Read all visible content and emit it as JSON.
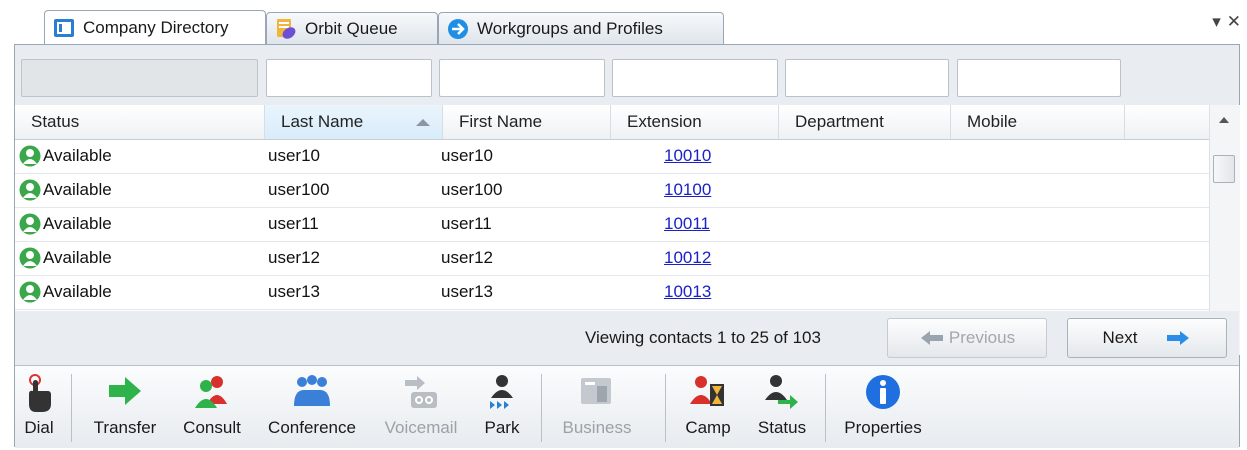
{
  "tabs": [
    {
      "label": "Company Directory",
      "icon": "directory-icon",
      "active": true
    },
    {
      "label": "Orbit Queue",
      "icon": "orbit-queue-icon",
      "active": false
    },
    {
      "label": "Workgroups and Profiles",
      "icon": "workgroups-icon",
      "active": false
    }
  ],
  "tab_controls": {
    "dropdown": "▾",
    "close": "✕"
  },
  "columns": [
    "Status",
    "Last Name",
    "First Name",
    "Extension",
    "Department",
    "Mobile"
  ],
  "sorted_column": "Last Name",
  "rows": [
    {
      "status": "Available",
      "last": "user10",
      "first": "user10",
      "ext": "10010",
      "dept": "",
      "mobile": ""
    },
    {
      "status": "Available",
      "last": "user100",
      "first": "user100",
      "ext": "10100",
      "dept": "",
      "mobile": ""
    },
    {
      "status": "Available",
      "last": "user11",
      "first": "user11",
      "ext": "10011",
      "dept": "",
      "mobile": ""
    },
    {
      "status": "Available",
      "last": "user12",
      "first": "user12",
      "ext": "10012",
      "dept": "",
      "mobile": ""
    },
    {
      "status": "Available",
      "last": "user13",
      "first": "user13",
      "ext": "10013",
      "dept": "",
      "mobile": ""
    }
  ],
  "pager": {
    "viewing": "Viewing contacts 1 to 25 of 103",
    "previous": "Previous",
    "next": "Next"
  },
  "toolbar": {
    "dial": "Dial",
    "transfer": "Transfer",
    "consult": "Consult",
    "conference": "Conference",
    "voicemail": "Voicemail",
    "park": "Park",
    "business": "Business",
    "camp": "Camp",
    "status": "Status",
    "properties": "Properties"
  },
  "colors": {
    "available": "#3aa84a",
    "link": "#1a22c8",
    "arrow_blue": "#2a8ee8",
    "transfer_green": "#2db34a",
    "consult_red": "#d8302a"
  }
}
